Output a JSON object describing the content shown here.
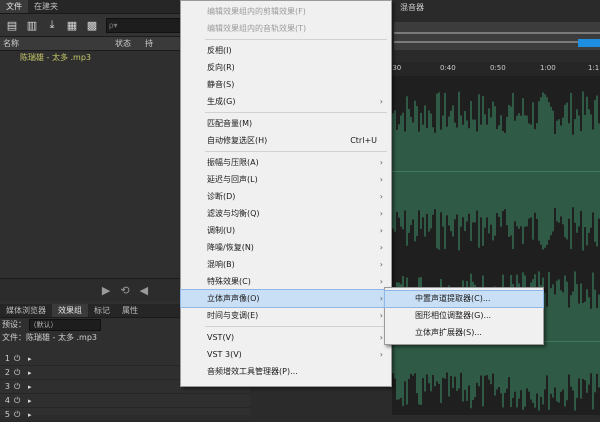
{
  "app": {
    "panel_tabs": [
      "文件",
      "在建夹"
    ],
    "file_list": {
      "search_placeholder": "ρ▾",
      "col_name": "名称",
      "col_status": "状态",
      "col_extra": "持",
      "files": [
        "陈瑞雄 - 太多 .mp3"
      ]
    },
    "lower_tabs": [
      "媒体浏览器",
      "效果组",
      "标记",
      "属性"
    ],
    "preset_label": "预设：",
    "preset_value": "（默认）",
    "effects_file": "文件：陈瑞雄 - 太多 .mp3",
    "rack_rows": [
      "1",
      "2",
      "3",
      "4",
      "5"
    ],
    "right_tab": "混音器",
    "timeline_ticks": [
      ":30",
      "0:40",
      "0:50",
      "1:00",
      "1:1"
    ]
  },
  "menu": {
    "items": [
      {
        "label": "编辑效果组内的剪辑效果(F)",
        "disabled": true
      },
      {
        "label": "编辑效果组内的音轨效果(T)",
        "disabled": true
      },
      {
        "label": "反相(I)"
      },
      {
        "label": "反向(R)"
      },
      {
        "label": "静音(S)"
      },
      {
        "label": "生成(G)",
        "submenu": true
      },
      {
        "label": "匹配音量(M)"
      },
      {
        "label": "自动修复选区(H)",
        "shortcut": "Ctrl+U"
      },
      {
        "label": "振幅与压限(A)",
        "submenu": true
      },
      {
        "label": "延迟与回声(L)",
        "submenu": true
      },
      {
        "label": "诊断(D)",
        "submenu": true
      },
      {
        "label": "滤波与均衡(Q)",
        "submenu": true
      },
      {
        "label": "调制(U)",
        "submenu": true
      },
      {
        "label": "降噪/恢复(N)",
        "submenu": true
      },
      {
        "label": "混响(B)",
        "submenu": true
      },
      {
        "label": "特殊效果(C)",
        "submenu": true
      },
      {
        "label": "立体声声像(O)",
        "submenu": true,
        "highlighted": true
      },
      {
        "label": "时间与变调(E)",
        "submenu": true
      },
      {
        "label": "VST(V)",
        "submenu": true
      },
      {
        "label": "VST 3(V)",
        "submenu": true
      },
      {
        "label": "音频增效工具管理器(P)..."
      }
    ],
    "submenu_arrow": "›"
  },
  "submenu": {
    "items": [
      {
        "label": "中置声道提取器(C)...",
        "highlighted": true
      },
      {
        "label": "图形相位调整器(G)..."
      },
      {
        "label": "立体声扩展器(S)..."
      }
    ]
  },
  "colors": {
    "menu_bg": "#f0f0f0",
    "highlight": "#c9dff5",
    "waveform": "#2f5a45",
    "accent_blue": "#1e8fe0"
  }
}
